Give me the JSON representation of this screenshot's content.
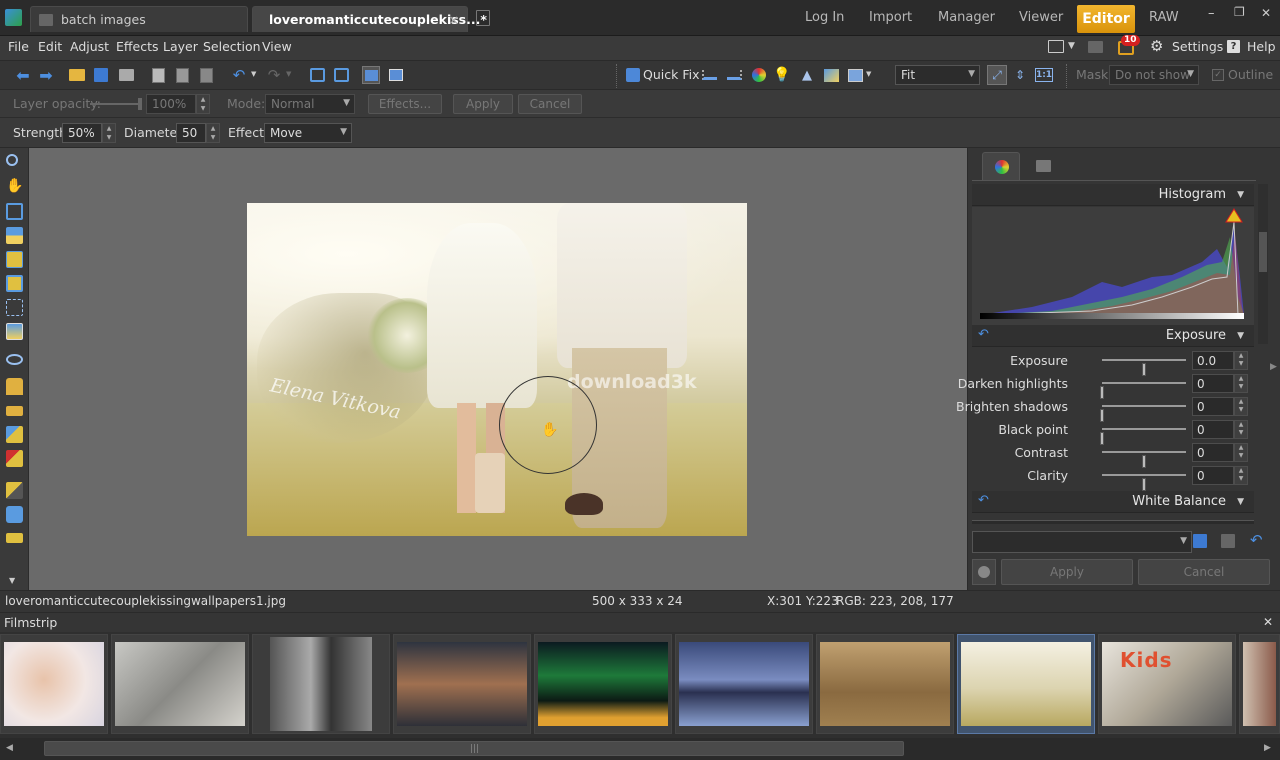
{
  "titlebar": {
    "tabs": [
      {
        "label": "batch images",
        "active": false
      },
      {
        "label": "loveromanticcutecouplekiss...*",
        "active": true,
        "close": "×"
      }
    ],
    "nav": [
      {
        "label": "Log In"
      },
      {
        "label": "Import"
      },
      {
        "label": "Manager"
      },
      {
        "label": "Viewer"
      },
      {
        "label": "Editor",
        "active": true
      },
      {
        "label": "RAW"
      }
    ],
    "window": {
      "minimize": "–",
      "restore": "❐",
      "close": "✕"
    }
  },
  "menubar": {
    "items": [
      "File",
      "Edit",
      "Adjust",
      "Effects",
      "Layer",
      "Selection",
      "View"
    ],
    "badge_count": "10",
    "settings_label": "Settings",
    "help_label": "Help"
  },
  "toolbar": {
    "quickfix_label": "Quick Fix",
    "zoom_value": "Fit",
    "mask_label": "Mask:",
    "mask_value": "Do not show",
    "outline_label": "Outline"
  },
  "layerbar": {
    "opacity_label": "Layer opacity:",
    "opacity_value": "100%",
    "mode_label": "Mode:",
    "mode_value": "Normal",
    "effects_label": "Effects...",
    "apply_label": "Apply",
    "cancel_label": "Cancel"
  },
  "toolopts": {
    "strength_label": "Strength:",
    "strength_value": "50%",
    "diameter_label": "Diameter:",
    "diameter_value": "50",
    "effect_label": "Effect:",
    "effect_value": "Move"
  },
  "canvas": {
    "watermark": "download3k",
    "signature": "Elena Vitkova"
  },
  "panel": {
    "histogram_title": "Histogram",
    "exposure_title": "Exposure",
    "whitebalance_title": "White Balance",
    "sliders": [
      {
        "label": "Exposure",
        "value": "0.0",
        "level": 0.5
      },
      {
        "label": "Darken highlights",
        "value": "0",
        "level": 0.0
      },
      {
        "label": "Brighten shadows",
        "value": "0",
        "level": 0.0
      },
      {
        "label": "Black point",
        "value": "0",
        "level": 0.0
      },
      {
        "label": "Contrast",
        "value": "0",
        "level": 0.5
      },
      {
        "label": "Clarity",
        "value": "0",
        "level": 0.5
      }
    ],
    "apply_label": "Apply",
    "cancel_label": "Cancel"
  },
  "status": {
    "filename": "loveromanticcutecouplekissingwallpapers1.jpg",
    "dimensions": "500 x 333 x 24",
    "coords": "X:301 Y:223",
    "rgb": "RGB: 223, 208, 177"
  },
  "filmstrip": {
    "title": "Filmstrip",
    "close": "✕"
  },
  "colors": {
    "accent": "#e7a21a",
    "selection": "#41546e"
  }
}
